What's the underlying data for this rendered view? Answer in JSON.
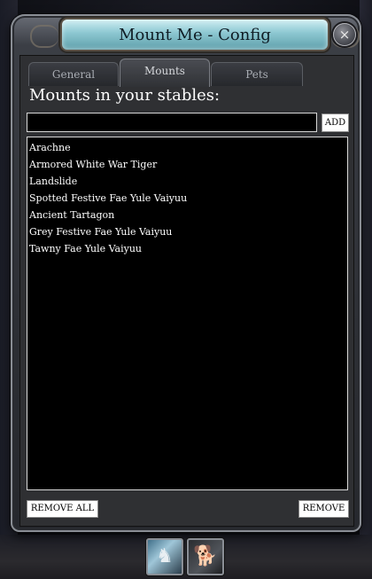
{
  "window": {
    "title": "Mount Me - Config",
    "close_icon": "×"
  },
  "tabs": [
    {
      "label": "General",
      "active": false
    },
    {
      "label": "Mounts",
      "active": true
    },
    {
      "label": "Pets",
      "active": false
    }
  ],
  "mounts_panel": {
    "heading": "Mounts in your stables:",
    "input_value": "",
    "add_label": "ADD",
    "items": [
      "Arachne",
      "Armored White War Tiger",
      "Landslide",
      "Spotted Festive Fae Yule Vaiyuu",
      "Ancient Tartagon",
      "Grey Festive Fae Yule Vaiyuu",
      "Tawny Fae Yule Vaiyuu"
    ],
    "remove_all_label": "REMOVE ALL",
    "remove_label": "REMOVE"
  },
  "hotbar": {
    "slots": [
      {
        "icon": "mount-armor-icon",
        "glyph": "♞"
      },
      {
        "icon": "pet-dog-icon",
        "glyph": "🐕"
      }
    ]
  },
  "colors": {
    "title_plate": "#8cc7d1",
    "panel_bg": "#2f3033",
    "list_bg": "#000000",
    "text": "#ffffff"
  }
}
